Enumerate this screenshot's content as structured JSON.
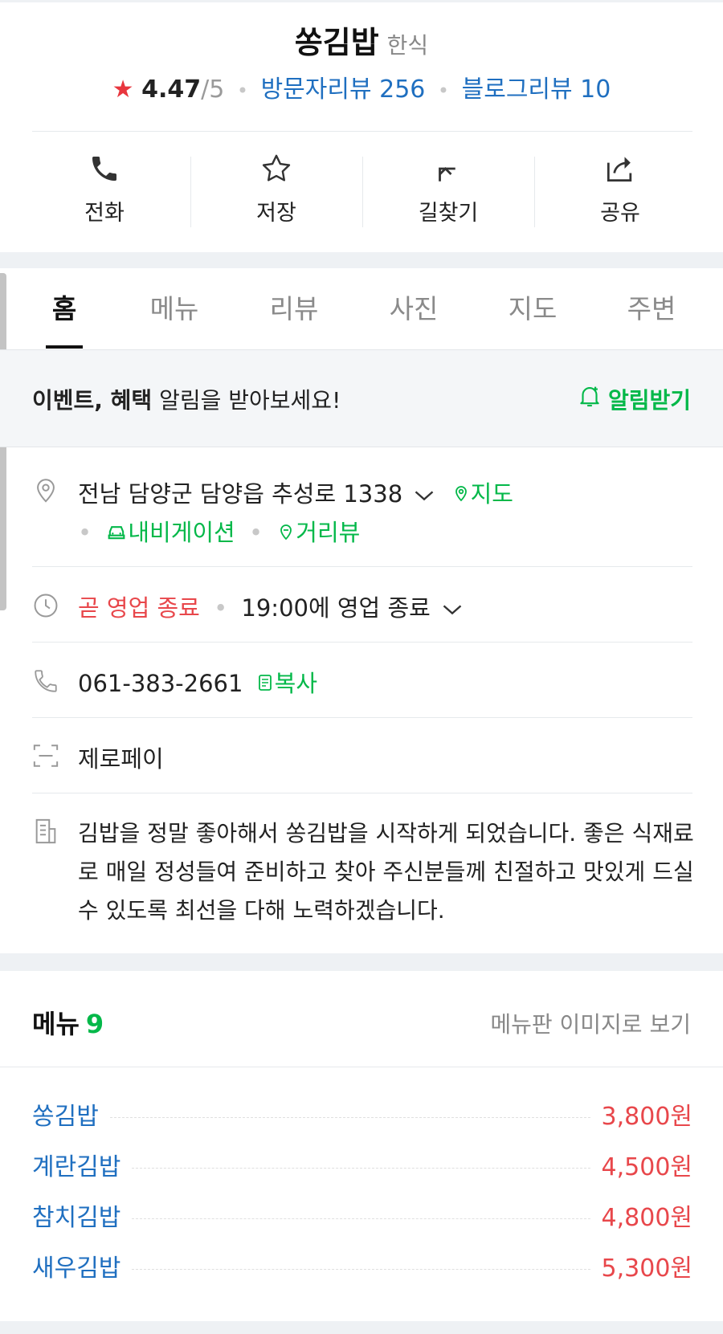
{
  "header": {
    "name": "쏭김밥",
    "category": "한식",
    "rating_star": "★",
    "rating_score": "4.47",
    "rating_max": "/5",
    "visitor_reviews": "방문자리뷰 256",
    "blog_reviews": "블로그리뷰 10",
    "rating_value": 4.47
  },
  "actions": [
    {
      "label": "전화",
      "icon": "phone-icon"
    },
    {
      "label": "저장",
      "icon": "star-outline-icon"
    },
    {
      "label": "길찾기",
      "icon": "directions-arrow-icon"
    },
    {
      "label": "공유",
      "icon": "share-icon"
    }
  ],
  "tabs": [
    {
      "label": "홈",
      "active": true
    },
    {
      "label": "메뉴",
      "active": false
    },
    {
      "label": "리뷰",
      "active": false
    },
    {
      "label": "사진",
      "active": false
    },
    {
      "label": "지도",
      "active": false
    },
    {
      "label": "주변",
      "active": false
    }
  ],
  "notice": {
    "bold_part": "이벤트, 혜택",
    "rest": " 알림을 받아보세요!",
    "button": "알림받기"
  },
  "info": {
    "address": "전남 담양군 담양읍 추성로 1338",
    "map_link": "지도",
    "navigation_link": "내비게이션",
    "streetview_link": "거리뷰",
    "hours_status": "곧 영업 종료",
    "hours_detail": "19:00에 영업 종료",
    "phone": "061-383-2661",
    "copy_label": "복사",
    "payment": "제로페이",
    "description": "김밥을 정말 좋아해서 쏭김밥을 시작하게 되었습니다. 좋은 식재료로 매일 정성들여 준비하고 찾아 주신분들께 친절하고 맛있게 드실 수 있도록 최선을 다해 노력하겠습니다."
  },
  "menu": {
    "title": "메뉴",
    "count": "9",
    "image_link": "메뉴판 이미지로 보기",
    "items": [
      {
        "name": "쏭김밥",
        "price": "3,800원"
      },
      {
        "name": "계란김밥",
        "price": "4,500원"
      },
      {
        "name": "참치김밥",
        "price": "4,800원"
      },
      {
        "name": "새우김밥",
        "price": "5,300원"
      }
    ]
  },
  "colors": {
    "accent_green": "#03b849",
    "link_blue": "#1f6fc0",
    "price_red": "#e8474b",
    "star_red": "#e8363e"
  }
}
